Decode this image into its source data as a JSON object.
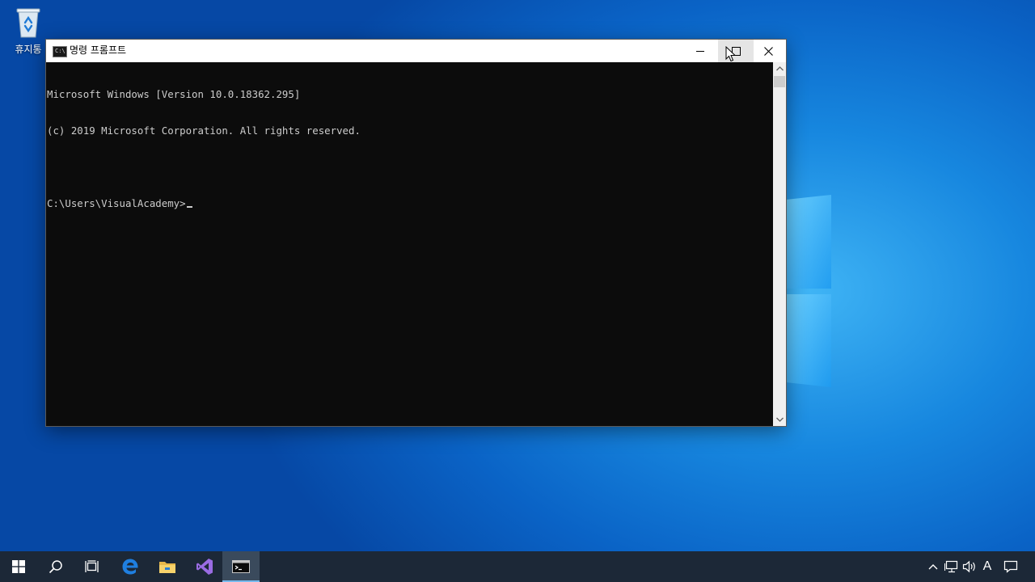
{
  "desktop": {
    "recycle_bin_label": "휴지통"
  },
  "window": {
    "title": "명령 프롬프트",
    "title_icon_text": "C:\\"
  },
  "console": {
    "lines": [
      "Microsoft Windows [Version 10.0.18362.295]",
      "(c) 2019 Microsoft Corporation. All rights reserved.",
      "",
      "C:\\Users\\VisualAcademy>"
    ]
  },
  "taskbar": {
    "items": [
      "windows-start",
      "search",
      "task-view",
      "edge",
      "file-explorer",
      "visual-studio",
      "command-prompt"
    ],
    "active_item": "command-prompt",
    "tray": {
      "input_language": "A"
    }
  },
  "colors": {
    "console_bg": "#0c0c0c",
    "console_text": "#cccccc",
    "taskbar_bg": "#1c2837",
    "accent": "#76b9ed"
  }
}
